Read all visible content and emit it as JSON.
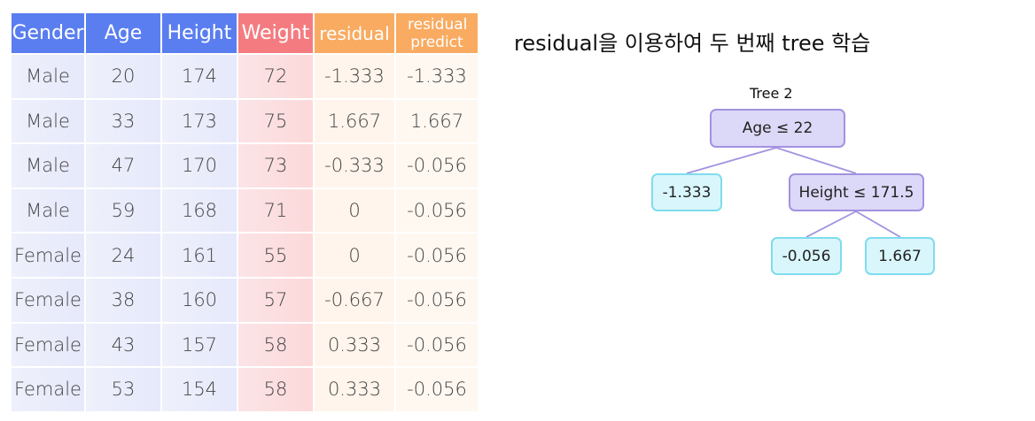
{
  "table": {
    "headers": [
      "Gender",
      "Age",
      "Height",
      "Weight",
      "residual",
      "residual predict"
    ],
    "rows": [
      [
        "Male",
        "20",
        "174",
        "72",
        "-1.333",
        "-1.333"
      ],
      [
        "Male",
        "33",
        "173",
        "75",
        "1.667",
        "1.667"
      ],
      [
        "Male",
        "47",
        "170",
        "73",
        "-0.333",
        "-0.056"
      ],
      [
        "Male",
        "59",
        "168",
        "71",
        "0",
        "-0.056"
      ],
      [
        "Female",
        "24",
        "161",
        "55",
        "0",
        "-0.056"
      ],
      [
        "Female",
        "38",
        "160",
        "57",
        "-0.667",
        "-0.056"
      ],
      [
        "Female",
        "43",
        "157",
        "58",
        "0.333",
        "-0.056"
      ],
      [
        "Female",
        "53",
        "154",
        "58",
        "0.333",
        "-0.056"
      ]
    ]
  },
  "heading": "residual을 이용하여 두 번째 tree 학습",
  "tree": {
    "title": "Tree 2",
    "root": "Age ≤ 22",
    "left_leaf": "-1.333",
    "right_split": "Height ≤ 171.5",
    "right_left_leaf": "-0.056",
    "right_right_leaf": "1.667"
  },
  "colors": {
    "header_blue": "#5a7ef0",
    "header_red": "#f47c80",
    "header_orange": "#f9ab61",
    "split_fill": "#dcd8f8",
    "split_border": "#a392e0",
    "leaf_fill": "#d9f6fc",
    "leaf_border": "#7fdcee"
  }
}
